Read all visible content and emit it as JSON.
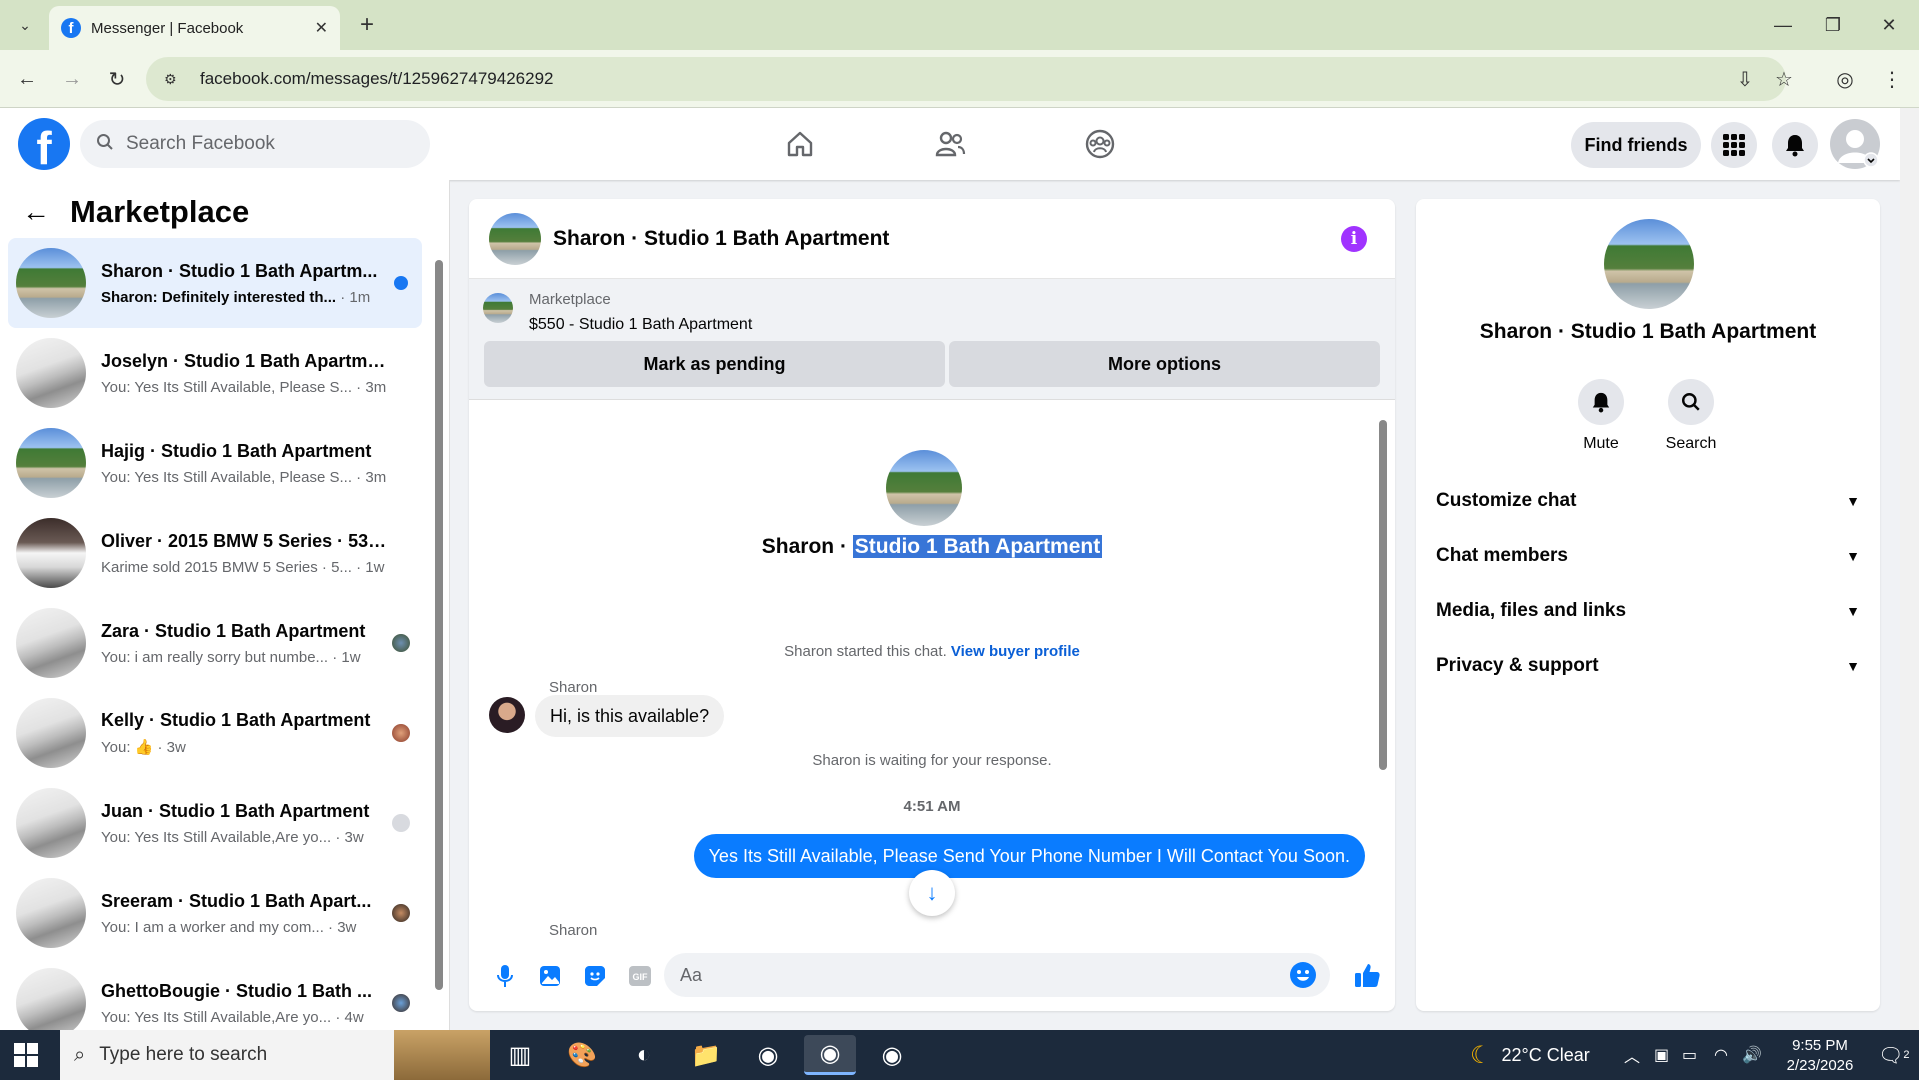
{
  "browser": {
    "tab_title": "Messenger | Facebook",
    "url": "facebook.com/messages/t/1259627479426292"
  },
  "fb_header": {
    "logo_letter": "f",
    "search_placeholder": "Search Facebook",
    "find_friends": "Find friends"
  },
  "sidebar": {
    "title": "Marketplace",
    "conversations": [
      {
        "name": "Sharon · Studio 1 Bath Apartm...",
        "preview": "Sharon: Definitely interested th...",
        "time": " · 1m",
        "unread": true
      },
      {
        "name": "Joselyn · Studio 1 Bath Apartment",
        "preview": "You: Yes Its Still Available, Please S...",
        "time": " · 3m"
      },
      {
        "name": "Hajig · Studio 1 Bath Apartment",
        "preview": "You: Yes Its Still Available, Please S...",
        "time": " · 3m"
      },
      {
        "name": "Oliver · 2015 BMW 5 Series · 535...",
        "preview": "Karime sold 2015 BMW 5 Series · 5...",
        "time": " · 1w"
      },
      {
        "name": "Zara · Studio 1 Bath Apartment",
        "preview": "You: i am really sorry but numbe...",
        "time": " · 1w"
      },
      {
        "name": "Kelly · Studio 1 Bath Apartment",
        "preview": "You: 👍",
        "time": " · 3w"
      },
      {
        "name": "Juan · Studio 1 Bath Apartment",
        "preview": "You: Yes Its Still Available,Are yo...",
        "time": " · 3w"
      },
      {
        "name": "Sreeram · Studio 1 Bath Apart...",
        "preview": "You: I am a worker and my com...",
        "time": " · 3w"
      },
      {
        "name": "GhettoBougie · Studio 1 Bath ...",
        "preview": "You: Yes Its Still Available,Are yo...",
        "time": " · 4w"
      }
    ]
  },
  "chat": {
    "header_name": "Sharon · Studio 1 Bath Apartment",
    "info_icon": "i",
    "marketplace_label": "Marketplace",
    "listing": "$550 - Studio 1 Bath Apartment",
    "mark_pending": "Mark as pending",
    "more_options": "More options",
    "center_name_prefix": "Sharon · ",
    "center_name_highlight": "Studio 1 Bath Apartment",
    "started_text": "Sharon started this chat. ",
    "view_buyer": "View buyer profile",
    "sender_name": "Sharon",
    "incoming_message": "Hi, is this available?",
    "waiting_text": "Sharon is waiting for your response.",
    "timestamp": "4:51 AM",
    "outgoing_message": "Yes Its Still Available, Please Send Your Phone Number I Will Contact You Soon.",
    "sender_name_2": "Sharon",
    "composer_placeholder": "Aa"
  },
  "info_panel": {
    "name": "Sharon · Studio 1 Bath Apartment",
    "mute": "Mute",
    "search": "Search",
    "sections": [
      "Customize chat",
      "Chat members",
      "Media, files and links",
      "Privacy & support"
    ]
  },
  "taskbar": {
    "search_placeholder": "Type here to search",
    "weather": "22°C  Clear",
    "time": "9:55 PM",
    "date": "2/23/2026",
    "notification_count": "2"
  },
  "colors": {
    "accent": "#1877f2",
    "messenger_blue": "#0a7cff",
    "info_purple": "#a033ff"
  }
}
